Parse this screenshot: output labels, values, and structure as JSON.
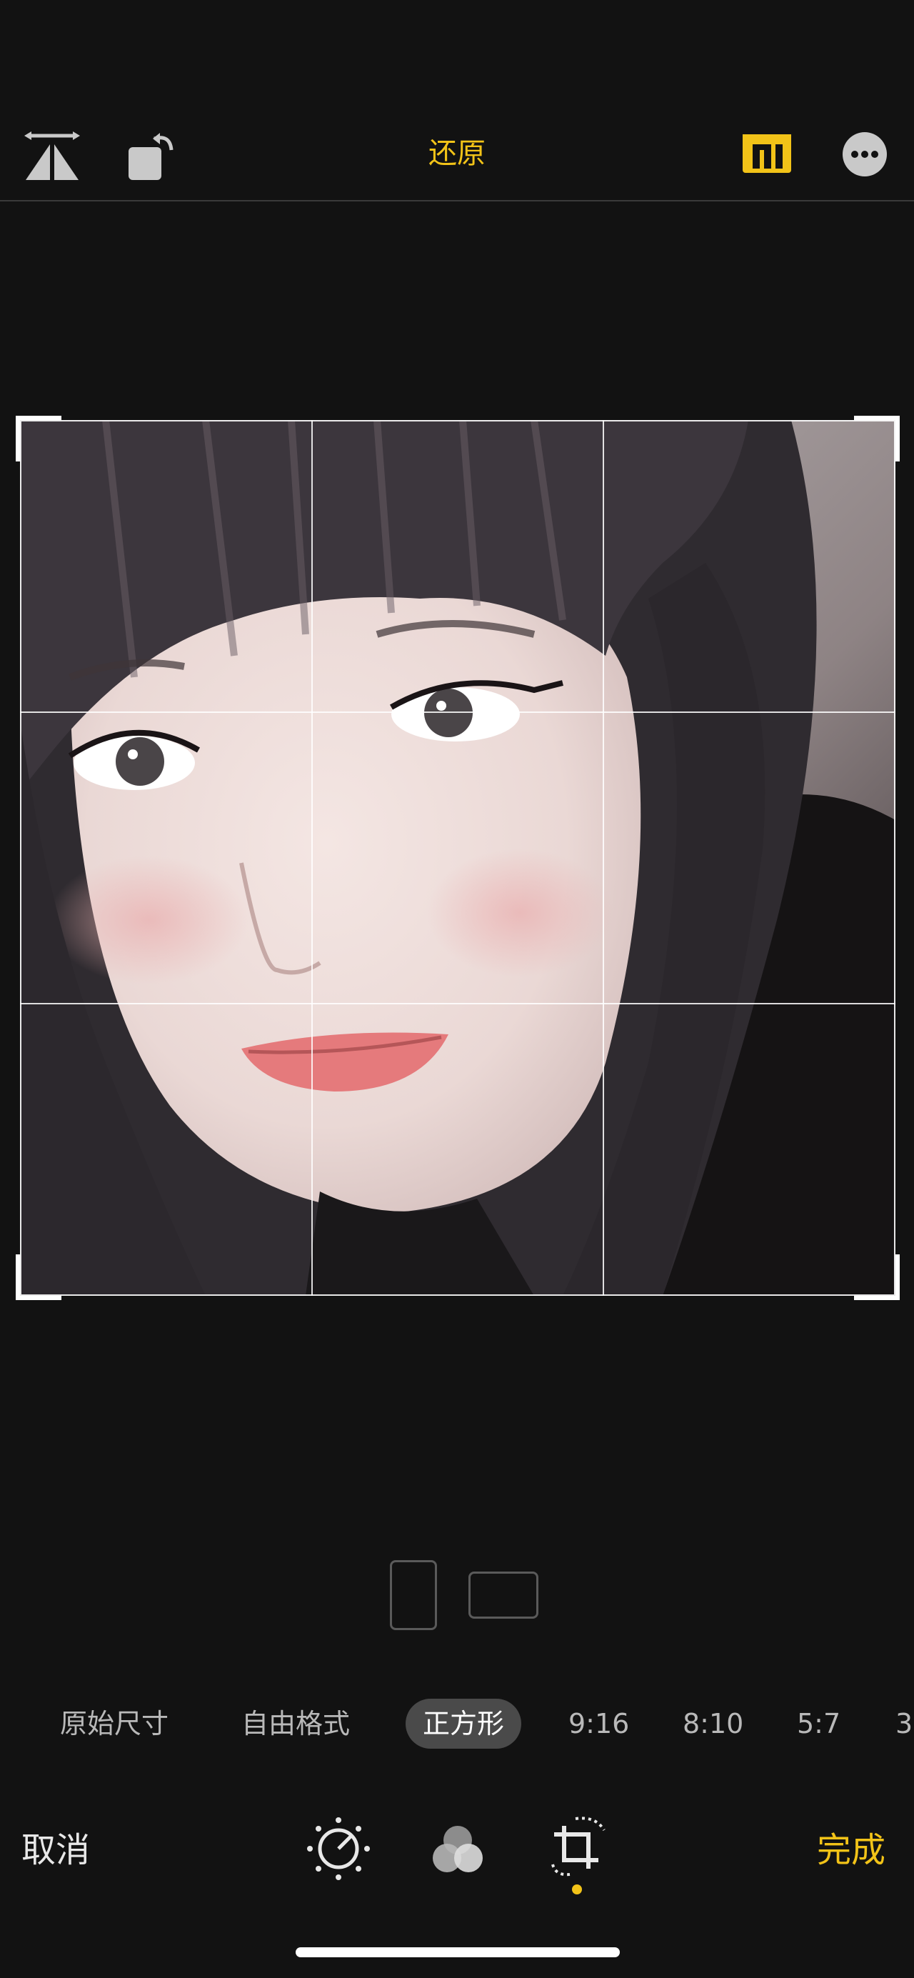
{
  "toolbar": {
    "reset_label": "还原",
    "icons": [
      "flip-horizontal-icon",
      "rotate-icon",
      "aspect-ratio-icon",
      "more-icon"
    ],
    "accent_color": "#f2c318"
  },
  "crop": {
    "grid": "3x3",
    "subject": "portrait photo of young woman with black hair and bangs"
  },
  "orientation": {
    "options": [
      "portrait",
      "landscape"
    ]
  },
  "aspect_ratios": {
    "items": [
      "原始尺寸",
      "自由格式",
      "正方形",
      "9:16",
      "8:10",
      "5:7",
      "3"
    ],
    "selected": "正方形"
  },
  "bottom": {
    "cancel_label": "取消",
    "done_label": "完成",
    "tools": [
      "adjust-icon",
      "filters-icon",
      "crop-rotate-icon"
    ],
    "active_tool": "crop-rotate-icon"
  }
}
